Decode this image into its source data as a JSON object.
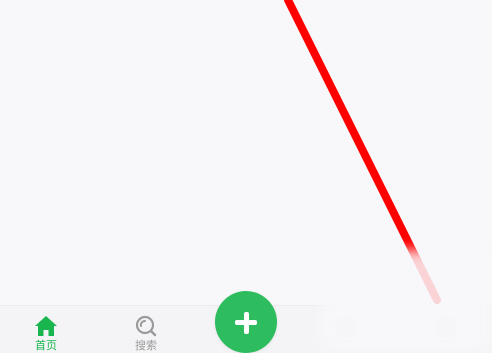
{
  "tabbar": {
    "home_label": "首页",
    "search_label": "搜索"
  },
  "icons": {
    "home": "home-icon",
    "search": "search-icon",
    "add": "plus-icon"
  },
  "colors": {
    "accent_green": "#19b64f",
    "add_button": "#2dbd5e",
    "inactive_gray": "#9a9a9a",
    "annotation_red": "#ff0000"
  }
}
